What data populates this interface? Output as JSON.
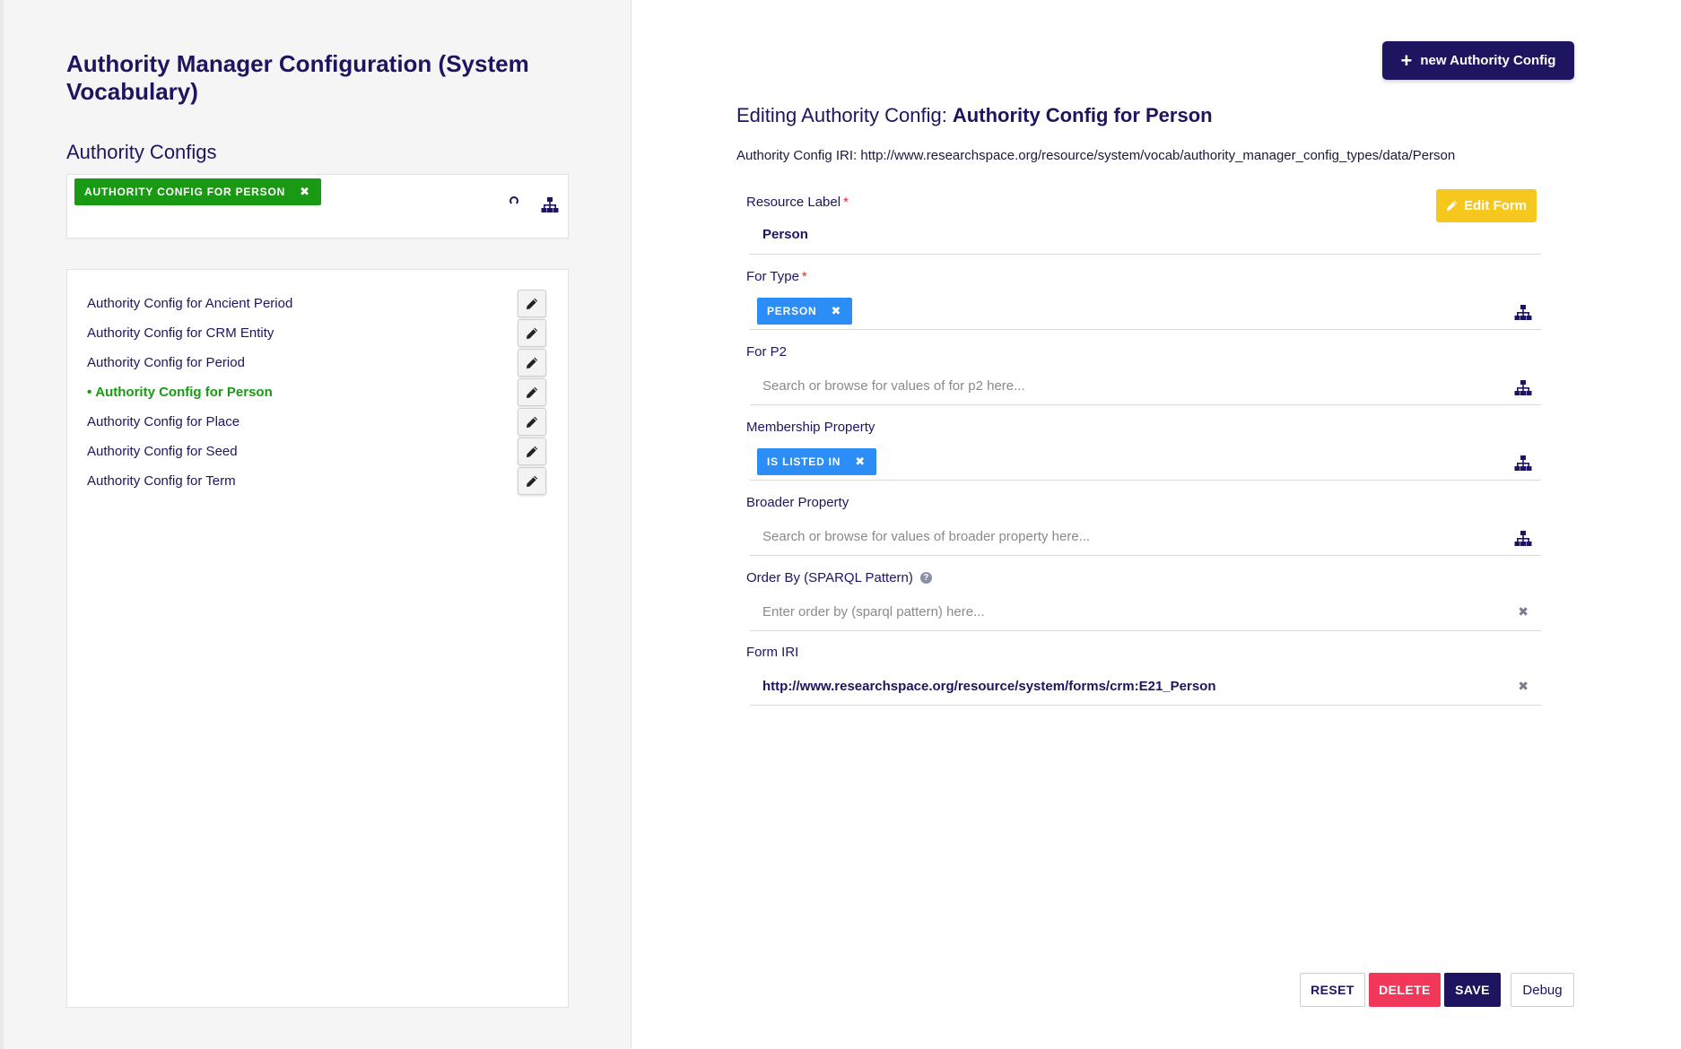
{
  "left": {
    "page_title": "Authority Manager Configuration (System Vocabulary)",
    "section_title": "Authority Configs",
    "selected_chip": "AUTHORITY CONFIG FOR PERSON",
    "chip_remove": "✖",
    "active_bullet": "•",
    "items": [
      {
        "label": "Authority Config for Ancient Period"
      },
      {
        "label": "Authority Config for CRM Entity"
      },
      {
        "label": "Authority Config for Period"
      },
      {
        "label": "Authority Config for Person"
      },
      {
        "label": "Authority Config for Place"
      },
      {
        "label": "Authority Config for Seed"
      },
      {
        "label": "Authority Config for Term"
      }
    ],
    "active_item": "Authority Config for Person",
    "icons": [
      "spinner-icon",
      "tree-icon",
      "pencil-icon"
    ]
  },
  "right": {
    "new_button": {
      "plus": "+",
      "label": "new Authority Config"
    },
    "editing_prefix": "Editing Authority Config: ",
    "editing_name": "Authority Config for Person",
    "iri_line": "Authority Config IRI: http://www.researchspace.org/resource/system/vocab/authority_manager_config_types/data/Person",
    "edit_form_button": "Edit Form",
    "fields": {
      "resource_label": {
        "label": "Resource Label",
        "required": "*",
        "value": "Person"
      },
      "for_type": {
        "label": "For Type",
        "required": "*",
        "chip": "PERSON"
      },
      "for_p2": {
        "label": "For P2",
        "placeholder": "Search or browse for values of for p2 here..."
      },
      "membership_property": {
        "label": "Membership Property",
        "chip": "IS LISTED IN"
      },
      "broader_property": {
        "label": "Broader Property",
        "placeholder": "Search or browse for values of broader property here..."
      },
      "order_by": {
        "label": "Order By (SPARQL Pattern)",
        "help": "?",
        "placeholder": "Enter order by (sparql pattern) here..."
      },
      "form_iri": {
        "label": "Form IRI",
        "value": "http://www.researchspace.org/resource/system/forms/crm:E21_Person"
      }
    },
    "clear": "✖",
    "buttons": {
      "reset": "RESET",
      "delete": "DELETE",
      "save": "SAVE",
      "debug": "Debug"
    }
  },
  "colors": {
    "brand": "#1e1560",
    "green": "#1a9a14",
    "blue": "#2b8df5",
    "yellow": "#f6c71c",
    "red": "#f2385a"
  }
}
